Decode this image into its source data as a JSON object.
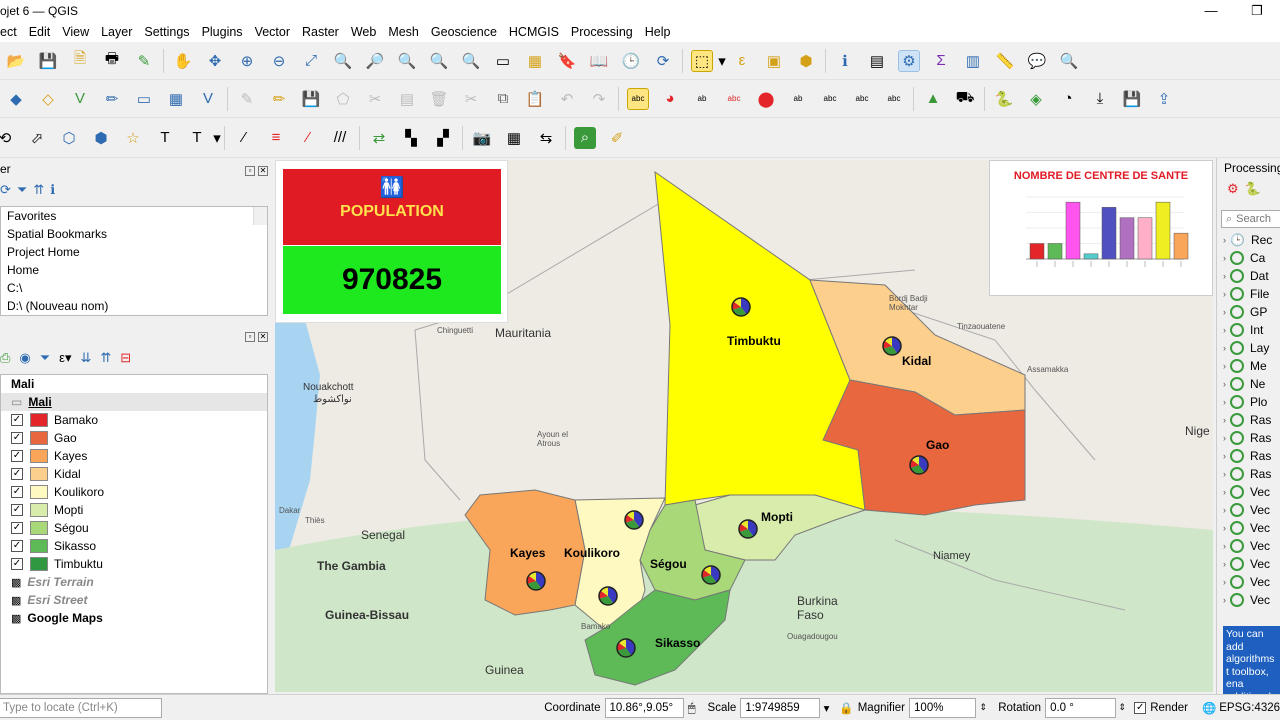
{
  "window": {
    "title": "rojet 6 — QGIS",
    "min": "—",
    "max": "❐"
  },
  "menu": [
    "ect",
    "Edit",
    "View",
    "Layer",
    "Settings",
    "Plugins",
    "Vector",
    "Raster",
    "Web",
    "Mesh",
    "Geoscience",
    "HCMGIS",
    "Processing",
    "Help"
  ],
  "browser": {
    "title": "er",
    "items": [
      "Favorites",
      "Spatial Bookmarks",
      "Project Home",
      "Home",
      "C:\\",
      "D:\\ (Nouveau nom)"
    ]
  },
  "layers": {
    "group": "Mali",
    "layer": "Mali",
    "classes": [
      {
        "label": "Bamako",
        "color": "#e3262a"
      },
      {
        "label": "Gao",
        "color": "#e8673f"
      },
      {
        "label": "Kayes",
        "color": "#f9a55a"
      },
      {
        "label": "Kidal",
        "color": "#fdcf8d"
      },
      {
        "label": "Koulikoro",
        "color": "#fdf9c0"
      },
      {
        "label": "Mopti",
        "color": "#d8ecab"
      },
      {
        "label": "Ségou",
        "color": "#a9d879"
      },
      {
        "label": "Sikasso",
        "color": "#5dba57"
      },
      {
        "label": "Timbuktu",
        "color": "#2f9840"
      }
    ],
    "basemaps": [
      "Esri Terrain",
      "Esri Street",
      "Google Maps"
    ]
  },
  "map": {
    "population_label": "POPULATION",
    "population_value": "970825",
    "chart_title": "NOMBRE DE CENTRE DE SANTE",
    "regions": [
      "Timbuktu",
      "Kidal",
      "Gao",
      "Mopti",
      "Kayes",
      "Koulikoro",
      "Ségou",
      "Sikasso"
    ],
    "places": [
      "Mauritania",
      "Nouakchott",
      "نواكشوط",
      "Senegal",
      "The Gambia",
      "Guinea-Bissau",
      "Guinea",
      "Burkina Faso",
      "Niamey",
      "Nige",
      "Bordj Badji Mokhtar",
      "Tinzaouatene",
      "Assamakka",
      "Chinguetti",
      "Ayoun el Atrous",
      "Dakar",
      "Thiès",
      "Ouagadougou",
      "Bamako"
    ]
  },
  "chart_data": {
    "type": "bar",
    "title": "NOMBRE DE CENTRE DE SANTE",
    "categories": [
      "c1",
      "c2",
      "c3",
      "c4",
      "c5",
      "c6",
      "c7",
      "c8",
      "c9"
    ],
    "values": [
      3,
      3,
      11,
      1,
      10,
      8,
      8,
      11,
      5
    ],
    "colors": [
      "#e3262a",
      "#5dba57",
      "#ff55ee",
      "#55cccc",
      "#5050c0",
      "#b070c0",
      "#ffb0c8",
      "#eeee22",
      "#f9a55a"
    ]
  },
  "processing": {
    "title": "Processing",
    "search_placeholder": "Search",
    "items": [
      "Rec",
      "Ca",
      "Dat",
      "File",
      "GP",
      "Int",
      "Lay",
      "Me",
      "Ne",
      "Plo",
      "Ras",
      "Ras",
      "Ras",
      "Ras",
      "Vec",
      "Vec",
      "Vec",
      "Vec",
      "Vec",
      "Vec",
      "Vec"
    ],
    "info": "You can add algorithms t toolbox, ena additional providers."
  },
  "status": {
    "locate_placeholder": "Type to locate (Ctrl+K)",
    "coordinate_label": "Coordinate",
    "coordinate_value": "10.86°,9.05°",
    "scale_label": "Scale",
    "scale_value": "1:9749859",
    "magnifier_label": "Magnifier",
    "magnifier_value": "100%",
    "rotation_label": "Rotation",
    "rotation_value": "0.0 °",
    "render_label": "Render",
    "crs": "EPSG:4326"
  }
}
